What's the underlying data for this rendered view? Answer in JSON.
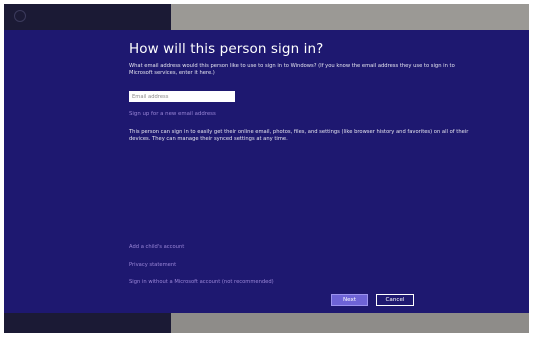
{
  "dialog": {
    "title": "How will this person sign in?",
    "description": "What email address would this person like to use to sign in to Windows? (If you know the email address they use to sign in to Microsoft services, enter it here.)",
    "email_placeholder": "Email address",
    "signup_link": "Sign up for a new email address",
    "info": "This person can sign in to easily get their online email, photos, files, and settings (like browser history and favorites) on all of their devices. They can manage their synced settings at any time.",
    "links": {
      "child_account": "Add a child's account",
      "privacy": "Privacy statement",
      "local_account": "Sign in without a Microsoft account (not recommended)"
    },
    "buttons": {
      "next": "Next",
      "cancel": "Cancel"
    }
  },
  "colors": {
    "dialog_bg": "#1e1870",
    "link": "#9a86d8",
    "next_button": "#6e63d6"
  }
}
